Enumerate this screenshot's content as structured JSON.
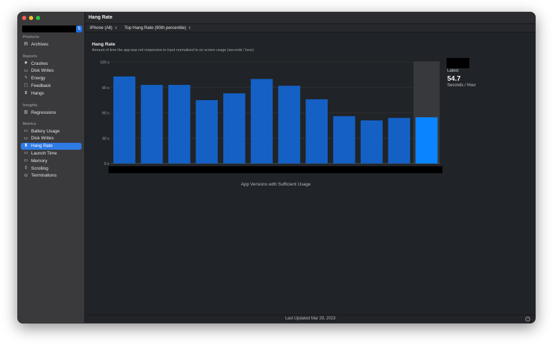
{
  "window": {
    "title": "Hang Rate"
  },
  "sidebar": {
    "sections": [
      {
        "label": "Products",
        "items": [
          {
            "label": "Archives",
            "icon": "archive-icon"
          }
        ]
      },
      {
        "label": "Reports",
        "items": [
          {
            "label": "Crashes",
            "icon": "crash-icon"
          },
          {
            "label": "Disk Writes",
            "icon": "disk-icon"
          },
          {
            "label": "Energy",
            "icon": "bolt-icon"
          },
          {
            "label": "Feedback",
            "icon": "feedback-icon"
          },
          {
            "label": "Hangs",
            "icon": "hourglass-icon"
          }
        ]
      },
      {
        "label": "Insights",
        "items": [
          {
            "label": "Regressions",
            "icon": "chart-bars-icon"
          }
        ]
      },
      {
        "label": "Metrics",
        "items": [
          {
            "label": "Battery Usage",
            "icon": "battery-icon"
          },
          {
            "label": "Disk Writes",
            "icon": "disk-icon"
          },
          {
            "label": "Hang Rate",
            "icon": "hourglass-icon",
            "active": true
          },
          {
            "label": "Launch Time",
            "icon": "launch-icon"
          },
          {
            "label": "Memory",
            "icon": "memory-icon"
          },
          {
            "label": "Scrolling",
            "icon": "scroll-icon"
          },
          {
            "label": "Terminations",
            "icon": "terminate-icon"
          }
        ]
      }
    ]
  },
  "toolbar": {
    "device_filter": "iPhone (All)",
    "metric_filter": "Top Hang Rate (90th percentile)"
  },
  "chart": {
    "title": "Hang Rate",
    "subtitle": "Amount of time the app was not responsive to input normalized to on screen usage (seconds / hour)",
    "x_axis_title": "App Versions with Sufficient Usage"
  },
  "latest": {
    "label": "Latest",
    "value": "54.7",
    "unit": "Seconds / Hour"
  },
  "footer": {
    "last_updated": "Last Updated Mar 29, 2023"
  },
  "colors": {
    "bar": "#1560c4",
    "bar_latest": "#0a84ff",
    "accent": "#2f7be5"
  },
  "chart_data": {
    "type": "bar",
    "y_tick_labels": [
      "0 s",
      "30 s",
      "60 s",
      "90 s",
      "120 s"
    ],
    "y_ticks": [
      0,
      30,
      60,
      90,
      120
    ],
    "ylim": [
      0,
      120
    ],
    "values": [
      103,
      93,
      93,
      75,
      83,
      100,
      92,
      76,
      56,
      51,
      54,
      54.7
    ],
    "highlight_index": 11,
    "grid": true
  }
}
